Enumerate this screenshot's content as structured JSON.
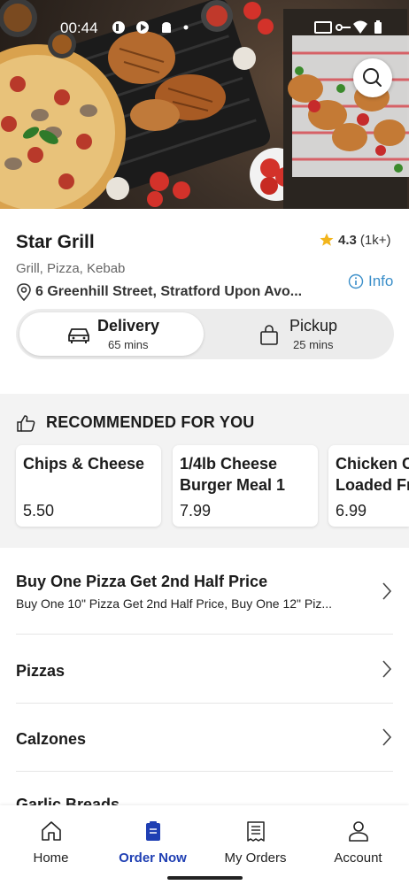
{
  "status_bar": {
    "time": "00:44"
  },
  "restaurant": {
    "name": "Star Grill",
    "rating": "4.3",
    "rating_count": "(1k+)",
    "cuisine": "Grill, Pizza, Kebab",
    "address": "6 Greenhill Street, Stratford Upon Avo...",
    "info_label": "Info"
  },
  "order_type": {
    "delivery": {
      "label": "Delivery",
      "time": "65 mins"
    },
    "pickup": {
      "label": "Pickup",
      "time": "25 mins"
    }
  },
  "recommended": {
    "heading": "RECOMMENDED FOR YOU",
    "items": [
      {
        "name": "Chips & Cheese",
        "price": "5.50"
      },
      {
        "name": "1/4lb Cheese Burger Meal 1",
        "price": "7.99"
      },
      {
        "name": "Chicken Cheese Loaded Fries",
        "price": "6.99"
      }
    ]
  },
  "categories": [
    {
      "title": "Buy One Pizza Get 2nd Half Price",
      "desc": "Buy One 10\" Pizza Get 2nd Half Price, Buy One 12\" Piz..."
    },
    {
      "title": "Pizzas"
    },
    {
      "title": "Calzones"
    },
    {
      "title": "Garlic Breads"
    }
  ],
  "bottom_nav": [
    {
      "label": "Home",
      "icon": "home-icon"
    },
    {
      "label": "Order Now",
      "icon": "order-icon"
    },
    {
      "label": "My Orders",
      "icon": "receipt-icon"
    },
    {
      "label": "Account",
      "icon": "person-icon"
    }
  ],
  "colors": {
    "accent": "#1f3fb3",
    "info": "#3a8ec9",
    "star": "#f2b51c"
  }
}
